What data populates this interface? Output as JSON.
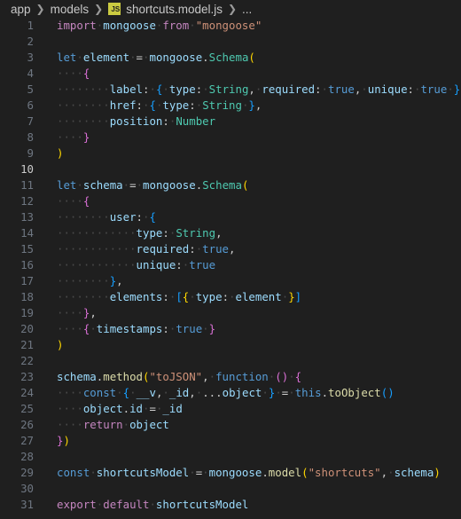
{
  "breadcrumb": {
    "parts": [
      "app",
      "models"
    ],
    "file_icon_text": "JS",
    "file_name": "shortcuts.model.js",
    "trailing": "..."
  },
  "active_line": 10,
  "colors": {
    "background": "#1f1f1f",
    "keyword": "#569cd6",
    "control": "#c586c0",
    "variable": "#9cdcfe",
    "function": "#dcdcaa",
    "class": "#4ec9b0",
    "string": "#ce9178",
    "bracket_1": "#ffd700",
    "bracket_2": "#da70d6",
    "bracket_3": "#179fff"
  },
  "lines": [
    {
      "n": "1",
      "t": [
        [
          "ctl",
          "import"
        ],
        [
          "ws",
          "·"
        ],
        [
          "id",
          "mongoose"
        ],
        [
          "ws",
          "·"
        ],
        [
          "ctl",
          "from"
        ],
        [
          "ws",
          "·"
        ],
        [
          "str",
          "\"mongoose\""
        ]
      ]
    },
    {
      "n": "2",
      "t": []
    },
    {
      "n": "3",
      "t": [
        [
          "kw",
          "let"
        ],
        [
          "ws",
          "·"
        ],
        [
          "id",
          "element"
        ],
        [
          "ws",
          "·"
        ],
        [
          "pun",
          "="
        ],
        [
          "ws",
          "·"
        ],
        [
          "id",
          "mongoose"
        ],
        [
          "pun",
          "."
        ],
        [
          "cls",
          "Schema"
        ],
        [
          "b1",
          "("
        ]
      ]
    },
    {
      "n": "4",
      "t": [
        [
          "ws",
          "····"
        ],
        [
          "b2",
          "{"
        ]
      ]
    },
    {
      "n": "5",
      "t": [
        [
          "ws",
          "········"
        ],
        [
          "id",
          "label"
        ],
        [
          "pun",
          ":"
        ],
        [
          "ws",
          "·"
        ],
        [
          "b3",
          "{"
        ],
        [
          "ws",
          "·"
        ],
        [
          "id",
          "type"
        ],
        [
          "pun",
          ":"
        ],
        [
          "ws",
          "·"
        ],
        [
          "cls",
          "String"
        ],
        [
          "pun",
          ","
        ],
        [
          "ws",
          "·"
        ],
        [
          "id",
          "required"
        ],
        [
          "pun",
          ":"
        ],
        [
          "ws",
          "·"
        ],
        [
          "tt",
          "true"
        ],
        [
          "pun",
          ","
        ],
        [
          "ws",
          "·"
        ],
        [
          "id",
          "unique"
        ],
        [
          "pun",
          ":"
        ],
        [
          "ws",
          "·"
        ],
        [
          "tt",
          "true"
        ],
        [
          "ws",
          "·"
        ],
        [
          "b3",
          "}"
        ],
        [
          "pun",
          ","
        ]
      ]
    },
    {
      "n": "6",
      "t": [
        [
          "ws",
          "········"
        ],
        [
          "id",
          "href"
        ],
        [
          "pun",
          ":"
        ],
        [
          "ws",
          "·"
        ],
        [
          "b3",
          "{"
        ],
        [
          "ws",
          "·"
        ],
        [
          "id",
          "type"
        ],
        [
          "pun",
          ":"
        ],
        [
          "ws",
          "·"
        ],
        [
          "cls",
          "String"
        ],
        [
          "ws",
          "·"
        ],
        [
          "b3",
          "}"
        ],
        [
          "pun",
          ","
        ]
      ]
    },
    {
      "n": "7",
      "t": [
        [
          "ws",
          "········"
        ],
        [
          "id",
          "position"
        ],
        [
          "pun",
          ":"
        ],
        [
          "ws",
          "·"
        ],
        [
          "cls",
          "Number"
        ]
      ]
    },
    {
      "n": "8",
      "t": [
        [
          "ws",
          "····"
        ],
        [
          "b2",
          "}"
        ]
      ]
    },
    {
      "n": "9",
      "t": [
        [
          "b1",
          ")"
        ]
      ]
    },
    {
      "n": "10",
      "t": []
    },
    {
      "n": "11",
      "t": [
        [
          "kw",
          "let"
        ],
        [
          "ws",
          "·"
        ],
        [
          "id",
          "schema"
        ],
        [
          "ws",
          "·"
        ],
        [
          "pun",
          "="
        ],
        [
          "ws",
          "·"
        ],
        [
          "id",
          "mongoose"
        ],
        [
          "pun",
          "."
        ],
        [
          "cls",
          "Schema"
        ],
        [
          "b1",
          "("
        ]
      ]
    },
    {
      "n": "12",
      "t": [
        [
          "ws",
          "····"
        ],
        [
          "b2",
          "{"
        ]
      ]
    },
    {
      "n": "13",
      "t": [
        [
          "ws",
          "········"
        ],
        [
          "id",
          "user"
        ],
        [
          "pun",
          ":"
        ],
        [
          "ws",
          "·"
        ],
        [
          "b3",
          "{"
        ]
      ]
    },
    {
      "n": "14",
      "t": [
        [
          "ws",
          "············"
        ],
        [
          "id",
          "type"
        ],
        [
          "pun",
          ":"
        ],
        [
          "ws",
          "·"
        ],
        [
          "cls",
          "String"
        ],
        [
          "pun",
          ","
        ]
      ]
    },
    {
      "n": "15",
      "t": [
        [
          "ws",
          "············"
        ],
        [
          "id",
          "required"
        ],
        [
          "pun",
          ":"
        ],
        [
          "ws",
          "·"
        ],
        [
          "tt",
          "true"
        ],
        [
          "pun",
          ","
        ]
      ]
    },
    {
      "n": "16",
      "t": [
        [
          "ws",
          "············"
        ],
        [
          "id",
          "unique"
        ],
        [
          "pun",
          ":"
        ],
        [
          "ws",
          "·"
        ],
        [
          "tt",
          "true"
        ]
      ]
    },
    {
      "n": "17",
      "t": [
        [
          "ws",
          "········"
        ],
        [
          "b3",
          "}"
        ],
        [
          "pun",
          ","
        ]
      ]
    },
    {
      "n": "18",
      "t": [
        [
          "ws",
          "········"
        ],
        [
          "id",
          "elements"
        ],
        [
          "pun",
          ":"
        ],
        [
          "ws",
          "·"
        ],
        [
          "b3",
          "["
        ],
        [
          "b1",
          "{"
        ],
        [
          "ws",
          "·"
        ],
        [
          "id",
          "type"
        ],
        [
          "pun",
          ":"
        ],
        [
          "ws",
          "·"
        ],
        [
          "id",
          "element"
        ],
        [
          "ws",
          "·"
        ],
        [
          "b1",
          "}"
        ],
        [
          "b3",
          "]"
        ]
      ]
    },
    {
      "n": "19",
      "t": [
        [
          "ws",
          "····"
        ],
        [
          "b2",
          "}"
        ],
        [
          "pun",
          ","
        ]
      ]
    },
    {
      "n": "20",
      "t": [
        [
          "ws",
          "····"
        ],
        [
          "b2",
          "{"
        ],
        [
          "ws",
          "·"
        ],
        [
          "id",
          "timestamps"
        ],
        [
          "pun",
          ":"
        ],
        [
          "ws",
          "·"
        ],
        [
          "tt",
          "true"
        ],
        [
          "ws",
          "·"
        ],
        [
          "b2",
          "}"
        ]
      ]
    },
    {
      "n": "21",
      "t": [
        [
          "b1",
          ")"
        ]
      ]
    },
    {
      "n": "22",
      "t": []
    },
    {
      "n": "23",
      "t": [
        [
          "id",
          "schema"
        ],
        [
          "pun",
          "."
        ],
        [
          "fn",
          "method"
        ],
        [
          "b1",
          "("
        ],
        [
          "str",
          "\"toJSON\""
        ],
        [
          "pun",
          ","
        ],
        [
          "ws",
          "·"
        ],
        [
          "kw",
          "function"
        ],
        [
          "ws",
          "·"
        ],
        [
          "b2",
          "("
        ],
        [
          "b2",
          ")"
        ],
        [
          "ws",
          "·"
        ],
        [
          "b2",
          "{"
        ]
      ]
    },
    {
      "n": "24",
      "t": [
        [
          "ws",
          "····"
        ],
        [
          "kw",
          "const"
        ],
        [
          "ws",
          "·"
        ],
        [
          "b3",
          "{"
        ],
        [
          "ws",
          "·"
        ],
        [
          "id",
          "__v"
        ],
        [
          "pun",
          ","
        ],
        [
          "ws",
          "·"
        ],
        [
          "id",
          "_id"
        ],
        [
          "pun",
          ","
        ],
        [
          "ws",
          "·"
        ],
        [
          "pun",
          "..."
        ],
        [
          "id",
          "object"
        ],
        [
          "ws",
          "·"
        ],
        [
          "b3",
          "}"
        ],
        [
          "ws",
          "·"
        ],
        [
          "pun",
          "="
        ],
        [
          "ws",
          "·"
        ],
        [
          "kw",
          "this"
        ],
        [
          "pun",
          "."
        ],
        [
          "fn",
          "toObject"
        ],
        [
          "b3",
          "("
        ],
        [
          "b3",
          ")"
        ]
      ]
    },
    {
      "n": "25",
      "t": [
        [
          "ws",
          "····"
        ],
        [
          "id",
          "object"
        ],
        [
          "pun",
          "."
        ],
        [
          "id",
          "id"
        ],
        [
          "ws",
          "·"
        ],
        [
          "pun",
          "="
        ],
        [
          "ws",
          "·"
        ],
        [
          "id",
          "_id"
        ]
      ]
    },
    {
      "n": "26",
      "t": [
        [
          "ws",
          "····"
        ],
        [
          "ctl",
          "return"
        ],
        [
          "ws",
          "·"
        ],
        [
          "id",
          "object"
        ]
      ]
    },
    {
      "n": "27",
      "t": [
        [
          "b2",
          "}"
        ],
        [
          "b1",
          ")"
        ]
      ]
    },
    {
      "n": "28",
      "t": []
    },
    {
      "n": "29",
      "t": [
        [
          "kw",
          "const"
        ],
        [
          "ws",
          "·"
        ],
        [
          "id",
          "shortcutsModel"
        ],
        [
          "ws",
          "·"
        ],
        [
          "pun",
          "="
        ],
        [
          "ws",
          "·"
        ],
        [
          "id",
          "mongoose"
        ],
        [
          "pun",
          "."
        ],
        [
          "fn",
          "model"
        ],
        [
          "b1",
          "("
        ],
        [
          "str",
          "\"shortcuts\""
        ],
        [
          "pun",
          ","
        ],
        [
          "ws",
          "·"
        ],
        [
          "id",
          "schema"
        ],
        [
          "b1",
          ")"
        ]
      ]
    },
    {
      "n": "30",
      "t": []
    },
    {
      "n": "31",
      "t": [
        [
          "ctl",
          "export"
        ],
        [
          "ws",
          "·"
        ],
        [
          "ctl",
          "default"
        ],
        [
          "ws",
          "·"
        ],
        [
          "id",
          "shortcutsModel"
        ]
      ]
    }
  ]
}
